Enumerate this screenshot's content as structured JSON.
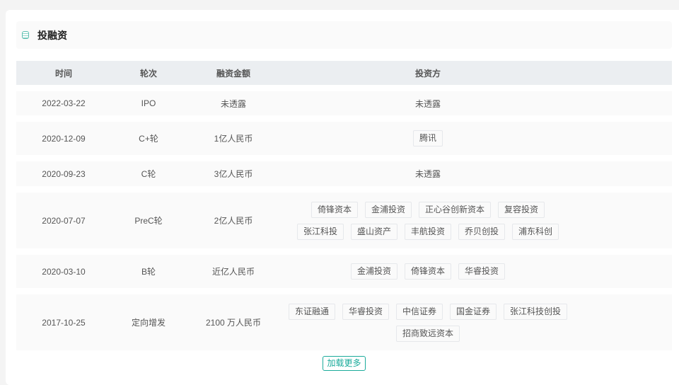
{
  "section": {
    "title": "投融资",
    "icon": "database-icon",
    "accent": "#1bab9b"
  },
  "columns": [
    "时间",
    "轮次",
    "融资金额",
    "投资方"
  ],
  "rows": [
    {
      "date": "2022-03-22",
      "round": "IPO",
      "amount": "未透露",
      "investors_text": "未透露",
      "investors": []
    },
    {
      "date": "2020-12-09",
      "round": "C+轮",
      "amount": "1亿人民币",
      "investors": [
        "腾讯"
      ]
    },
    {
      "date": "2020-09-23",
      "round": "C轮",
      "amount": "3亿人民币",
      "investors_text": "未透露",
      "investors": []
    },
    {
      "date": "2020-07-07",
      "round": "PreC轮",
      "amount": "2亿人民币",
      "investors": [
        "倚锋资本",
        "金浦投资",
        "正心谷创新资本",
        "复容投资",
        "张江科投",
        "盛山资产",
        "丰航投资",
        "乔贝创投",
        "浦东科创"
      ]
    },
    {
      "date": "2020-03-10",
      "round": "B轮",
      "amount": "近亿人民币",
      "investors": [
        "金浦投资",
        "倚锋资本",
        "华睿投资"
      ]
    },
    {
      "date": "2017-10-25",
      "round": "定向增发",
      "amount": "2100 万人民币",
      "investors": [
        "东证融通",
        "华睿投资",
        "中信证券",
        "国金证券",
        "张江科技创投",
        "招商致远资本"
      ]
    }
  ],
  "load_more": "加载更多"
}
